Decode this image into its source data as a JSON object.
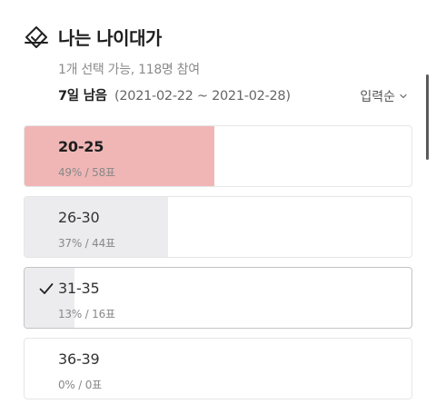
{
  "poll": {
    "title": "나는 나이대가",
    "meta": "1개 선택 가능, 118명 참여",
    "remaining": "7일 남음",
    "date_range": "(2021-02-22 ~ 2021-02-28)",
    "sort_label": "입력순"
  },
  "options": [
    {
      "label": "20-25",
      "stat": "49% / 58표",
      "percent": 49,
      "votes": 58,
      "leading": true,
      "selected": false
    },
    {
      "label": "26-30",
      "stat": "37% / 44표",
      "percent": 37,
      "votes": 44,
      "leading": false,
      "selected": false
    },
    {
      "label": "31-35",
      "stat": "13% / 16표",
      "percent": 13,
      "votes": 16,
      "leading": false,
      "selected": true
    },
    {
      "label": "36-39",
      "stat": "0% / 0표",
      "percent": 0,
      "votes": 0,
      "leading": false,
      "selected": false
    }
  ],
  "colors": {
    "leading_fill": "#f0b6b6",
    "fill": "#ececee"
  },
  "icons": {
    "header": "ballot-check-icon",
    "sort": "chevron-down-icon",
    "selected": "checkmark-icon"
  }
}
